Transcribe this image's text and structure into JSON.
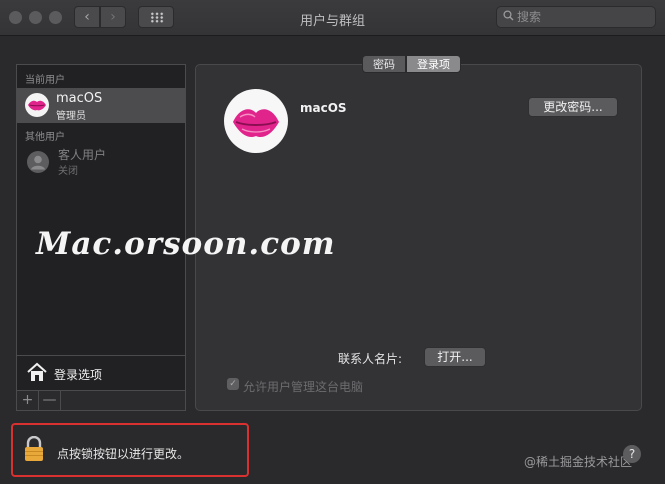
{
  "window": {
    "title": "用户与群组"
  },
  "search": {
    "placeholder": "搜索"
  },
  "sidebar": {
    "current_users_label": "当前用户",
    "current_user": {
      "name": "macOS",
      "role": "管理员"
    },
    "other_users_label": "其他用户",
    "guest_user": {
      "name": "客人用户",
      "status": "关闭"
    },
    "login_options_label": "登录选项",
    "add_label": "+",
    "remove_label": "—"
  },
  "tabs": [
    {
      "label": "密码"
    },
    {
      "label": "登录项"
    }
  ],
  "main": {
    "user_name": "macOS",
    "change_password_label": "更改密码...",
    "contact_card_label": "联系人名片:",
    "open_label": "打开...",
    "allow_admin_label": "允许用户管理这台电脑"
  },
  "watermark": "Mac.orsoon.com",
  "footer": {
    "lock_text": "点按锁按钮以进行更改。",
    "credit_text": "@稀土掘金技术社区",
    "help_label": "?"
  },
  "colors": {
    "lock_highlight": "#d93030",
    "lips": "#e0248c",
    "background": "#2a2a2c"
  }
}
